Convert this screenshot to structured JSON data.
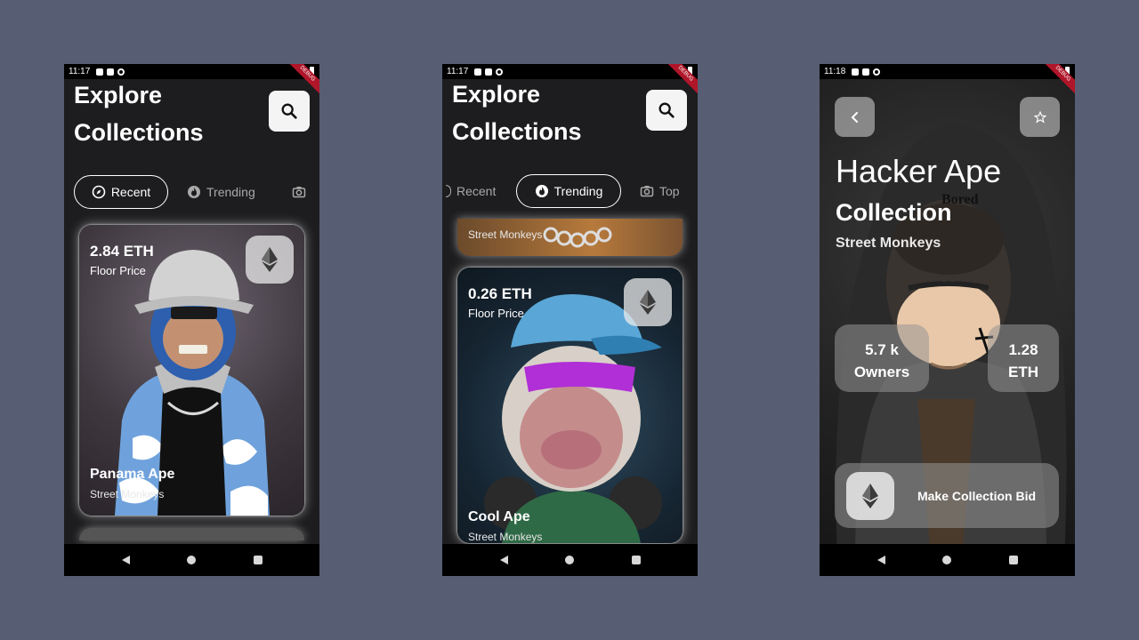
{
  "status": {
    "time1": "11:17",
    "time2": "11:17",
    "time3": "11:18",
    "debug": "DEBUG"
  },
  "explore": {
    "line1": "Explore",
    "line2": "Collections"
  },
  "tabs": {
    "recent": "Recent",
    "trending": "Trending",
    "top": "Top"
  },
  "screen1": {
    "card": {
      "price": "2.84 ETH",
      "price_label": "Floor Price",
      "name": "Panama Ape",
      "collection": "Street Monkeys"
    }
  },
  "screen2": {
    "prev_card": {
      "collection": "Street Monkeys"
    },
    "card": {
      "price": "0.26 ETH",
      "price_label": "Floor Price",
      "name": "Cool Ape",
      "collection": "Street Monkeys"
    }
  },
  "detail": {
    "title": "Hacker Ape",
    "subtitle": "Collection",
    "collection": "Street Monkeys",
    "owners_value": "5.7 k",
    "owners_label": "Owners",
    "floor_value": "1.28",
    "floor_unit": "ETH",
    "bid_label": "Make Collection Bid",
    "hoodie_text": "Bored"
  },
  "colors": {
    "background": "#575d72",
    "phone_bg": "#1d1d1f",
    "debug_ribbon": "#b01629"
  }
}
